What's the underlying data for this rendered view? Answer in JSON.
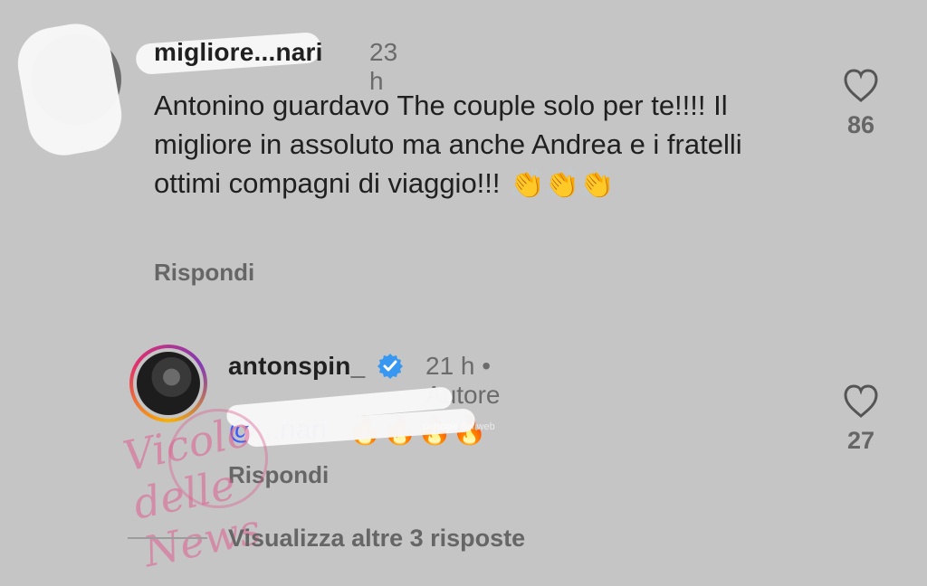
{
  "comments": [
    {
      "username": "migliore...nari",
      "time": "23 h",
      "text": "Antonino guardavo The couple solo per te!!!! Il migliore in assoluto ma anche Andrea e i fratelli ottimi compagni di viaggio!!!",
      "emoji": "👏👏👏",
      "reply_label": "Rispondi",
      "likes": "86"
    },
    {
      "username": "antonspin_",
      "time": "21 h",
      "meta_separator": "•",
      "author_label": "Autore",
      "mention_text": "@...nari",
      "emoji": "🔥🔥🔥🔥",
      "reply_label": "Rispondi",
      "likes": "27"
    }
  ],
  "footer": {
    "view_more": "Visualizza altre 3 risposte"
  },
  "watermark": {
    "left_text": "Vicolo delle News",
    "center_text": "principe del web"
  },
  "icons": {
    "heart": "heart-icon",
    "verified": "verified-icon"
  },
  "colors": {
    "background": "#c5c5c5",
    "text": "#202020",
    "muted": "#666666",
    "verified": "#3897f0",
    "mention": "#3b5bff"
  }
}
